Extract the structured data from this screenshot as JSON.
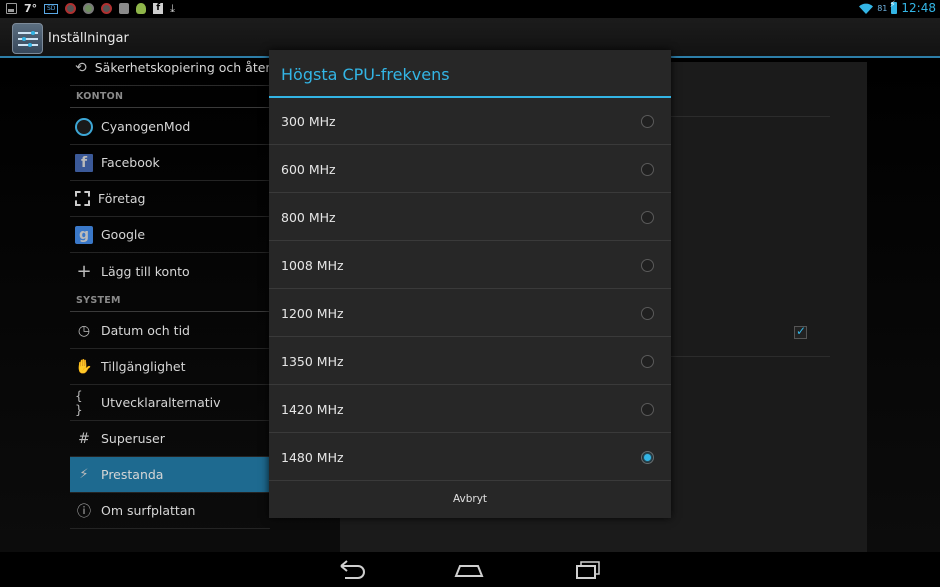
{
  "status_bar": {
    "temperature": "7°",
    "battery_level": "81",
    "time": "12:48",
    "icons": [
      "gallery-icon",
      "sim-icon",
      "blocked-app-icon",
      "app-icon",
      "shield-icon",
      "android-icon",
      "facebook-icon",
      "download-icon",
      "wifi-icon",
      "battery-charging-icon"
    ]
  },
  "action_bar": {
    "title": "Inställningar",
    "icon": "settings-icon"
  },
  "settings_list": {
    "items_top": [
      {
        "label": "Säkerhetskopiering och åters",
        "icon": "backup-icon"
      }
    ],
    "accounts_header": "KONTON",
    "accounts": [
      {
        "label": "CyanogenMod",
        "icon": "cyanogenmod-icon"
      },
      {
        "label": "Facebook",
        "icon": "facebook-icon"
      },
      {
        "label": "Företag",
        "icon": "corporate-icon"
      },
      {
        "label": "Google",
        "icon": "google-icon"
      },
      {
        "label": "Lägg till konto",
        "icon": "plus-icon"
      }
    ],
    "system_header": "SYSTEM",
    "system": [
      {
        "label": "Datum och tid",
        "icon": "clock-icon"
      },
      {
        "label": "Tillgänglighet",
        "icon": "hand-icon"
      },
      {
        "label": "Utvecklaralternativ",
        "icon": "braces-icon"
      },
      {
        "label": "Superuser",
        "icon": "hash-icon"
      },
      {
        "label": "Prestanda",
        "icon": "performance-icon",
        "active": true
      },
      {
        "label": "Om surfplattan",
        "icon": "info-icon"
      }
    ]
  },
  "dialog": {
    "title": "Högsta CPU-frekvens",
    "options": [
      {
        "label": "300 MHz",
        "selected": false
      },
      {
        "label": "600 MHz",
        "selected": false
      },
      {
        "label": "800 MHz",
        "selected": false
      },
      {
        "label": "1008 MHz",
        "selected": false
      },
      {
        "label": "1200 MHz",
        "selected": false
      },
      {
        "label": "1350 MHz",
        "selected": false
      },
      {
        "label": "1420 MHz",
        "selected": false
      },
      {
        "label": "1480 MHz",
        "selected": true
      }
    ],
    "cancel_label": "Avbryt"
  },
  "nav_bar": {
    "buttons": [
      "back-icon",
      "home-icon",
      "recent-apps-icon"
    ]
  },
  "colors": {
    "accent": "#33b5e5",
    "active_row": "#1e6a90",
    "dialog_bg": "#272727"
  }
}
